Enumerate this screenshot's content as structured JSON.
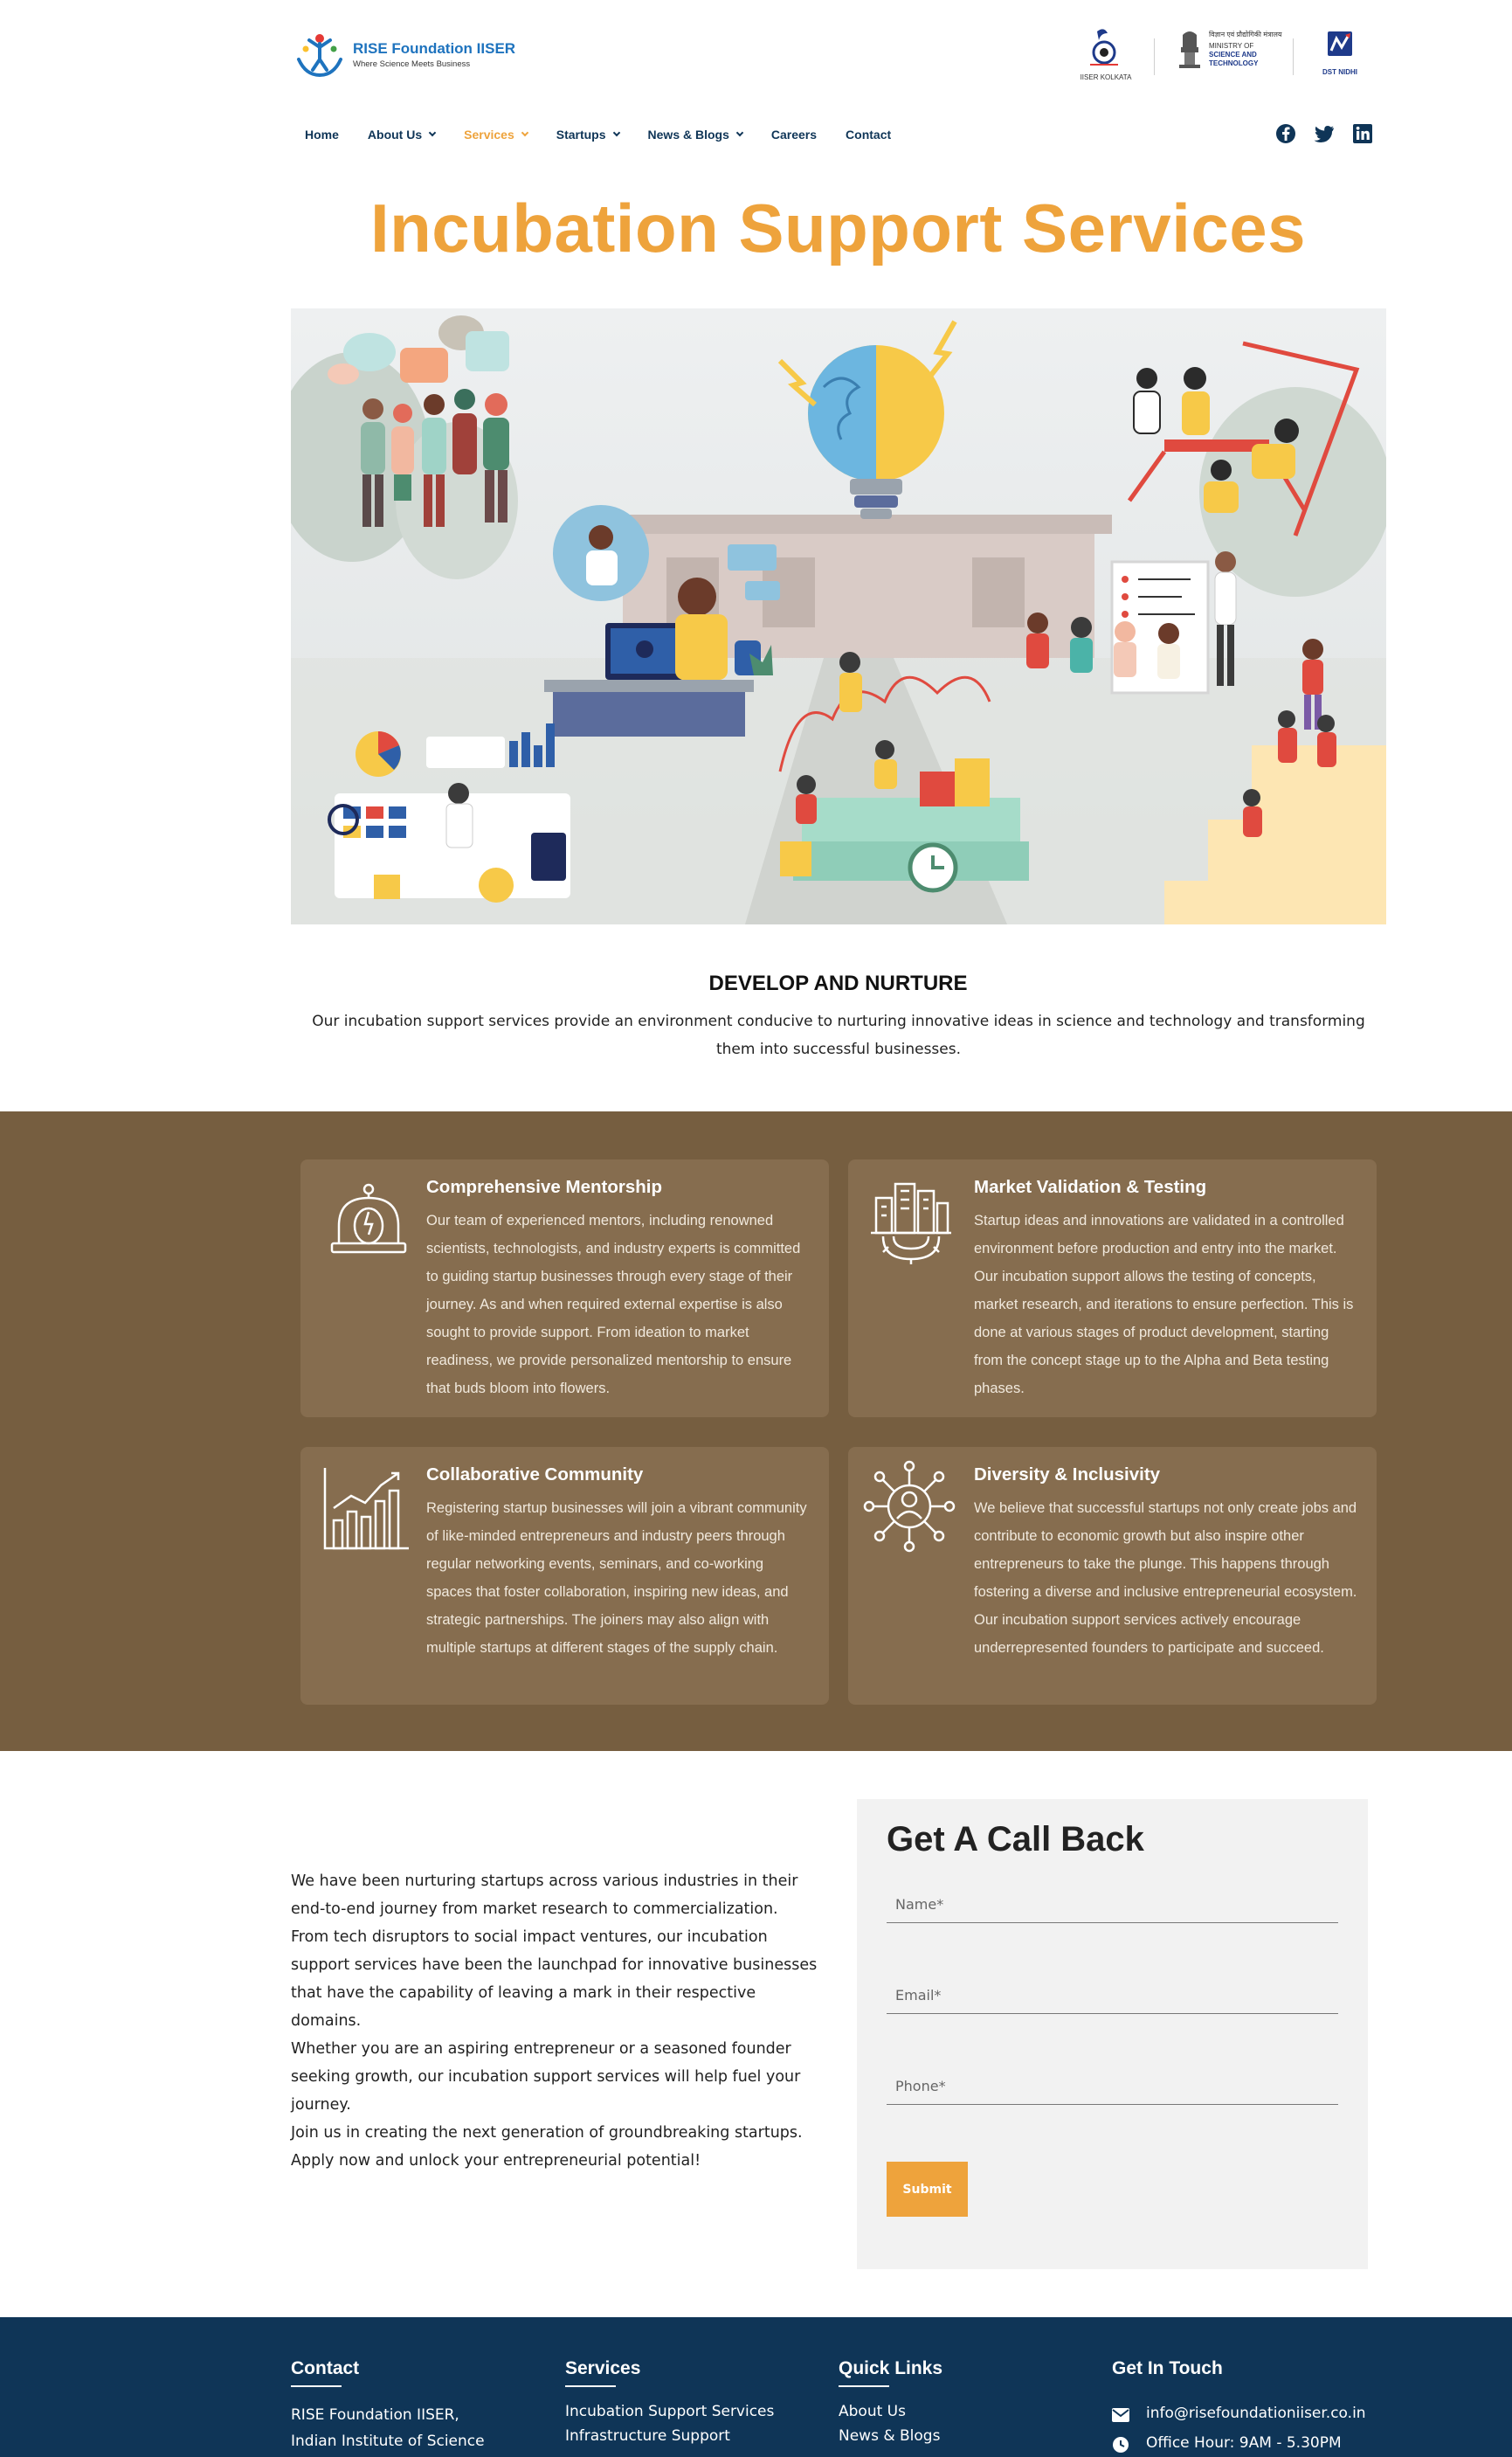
{
  "brand": {
    "name": "RISE Foundation IISER",
    "tagline": "Where Science Meets Business"
  },
  "partners": {
    "iiser": "IISER KOLKATA",
    "ministry_hindi": "विज्ञान एवं प्रौद्योगिकी मंत्रालय",
    "ministry_line1": "MINISTRY OF",
    "ministry_line2": "SCIENCE AND",
    "ministry_line3": "TECHNOLOGY",
    "dst": "DST NIDHI"
  },
  "nav": {
    "items": [
      {
        "label": "Home"
      },
      {
        "label": "About Us"
      },
      {
        "label": "Services"
      },
      {
        "label": "Startups"
      },
      {
        "label": "News & Blogs"
      },
      {
        "label": "Careers"
      },
      {
        "label": "Contact"
      }
    ],
    "active_color": "#eea33c",
    "color": "#0f3557"
  },
  "page": {
    "title": "Incubation Support Services",
    "accent": "#eea33c"
  },
  "develop": {
    "title": "DEVELOP AND NURTURE",
    "text": "Our incubation support services provide an environment conducive to nurturing innovative ideas in science and technology and transforming them into successful businesses."
  },
  "features": {
    "band_color": "#765e40",
    "card_color": "#866d4f",
    "items": [
      {
        "icon": "bell-jar-icon",
        "title": "Comprehensive Mentorship",
        "text": "Our team of experienced mentors, including renowned scientists, technologists, and industry experts is committed to guiding startup businesses through every stage of their journey. As and when required external expertise is also sought to provide support. From ideation to market readiness, we provide personalized mentorship to ensure that buds bloom into flowers."
      },
      {
        "icon": "city-gear-icon",
        "title": "Market Validation & Testing",
        "text": "Startup ideas and innovations are validated in a controlled environment before production and entry into the market. Our incubation support allows the testing of concepts, market research, and iterations to ensure perfection. This is done at various stages of product development, starting from the concept stage up to the Alpha and Beta testing phases."
      },
      {
        "icon": "growth-chart-icon",
        "title": "Collaborative Community",
        "text": "Registering startup businesses will join a vibrant community of like-minded entrepreneurs and industry peers through regular networking events, seminars, and co-working spaces that foster collaboration, inspiring new ideas, and strategic partnerships. The joiners may also align with multiple startups at different stages of the supply chain."
      },
      {
        "icon": "network-people-icon",
        "title": "Diversity & Inclusivity",
        "text": "We believe that successful startups not only create jobs and contribute to economic growth but also inspire other entrepreneurs to take the plunge. This happens through fostering a diverse and inclusive entrepreneurial ecosystem. Our incubation support services actively encourage underrepresented founders to participate and succeed."
      }
    ]
  },
  "intro": {
    "p1": "We have been nurturing startups across various industries in their end-to-end journey from market research to commercialization.",
    "p2": "From tech disruptors to social impact ventures, our incubation support services have been the launchpad for innovative businesses that have the capability of leaving a mark in their respective domains.",
    "p3": "Whether you are an aspiring entrepreneur or a seasoned founder seeking growth, our incubation support services will help fuel your journey.",
    "p4": "Join us in creating the next generation of groundbreaking startups. Apply now and unlock your entrepreneurial potential!"
  },
  "form": {
    "title": "Get A Call Back",
    "name_placeholder": "Name*",
    "email_placeholder": "Email*",
    "phone_placeholder": "Phone*",
    "submit_label": "Submit"
  },
  "footer": {
    "bg": "#0f3557",
    "contact": {
      "heading": "Contact",
      "line1": "RISE Foundation IISER,",
      "line2": "Indian Institute of Science"
    },
    "services": {
      "heading": "Services",
      "line1": "Incubation Support Services",
      "line2": "Infrastructure Support"
    },
    "quick_links": {
      "heading": "Quick Links",
      "line1": "About Us",
      "line2": "News & Blogs"
    },
    "get_in_touch": {
      "heading": "Get In Touch",
      "email": "info@risefoundationiiser.co.in",
      "hours": "Office Hour: 9AM - 5.30PM"
    }
  }
}
